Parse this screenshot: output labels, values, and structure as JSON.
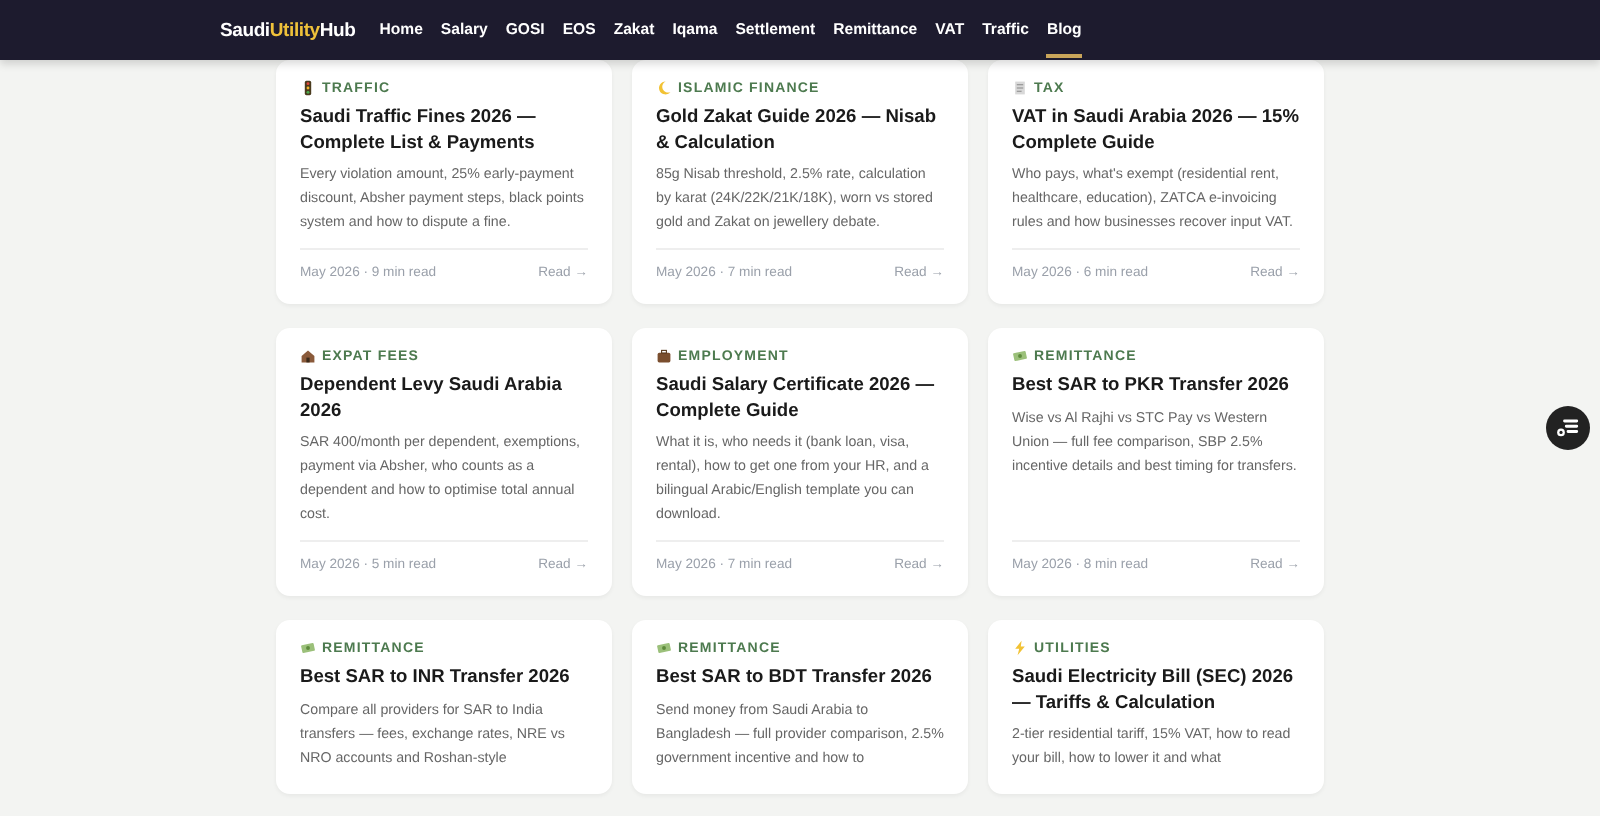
{
  "nav": {
    "logo": [
      {
        "text": "Saudi",
        "highlight": false
      },
      {
        "text": "Utility",
        "highlight": true
      },
      {
        "text": "Hub",
        "highlight": false
      }
    ],
    "links": [
      {
        "label": "Home",
        "selected": false
      },
      {
        "label": "Salary",
        "selected": false
      },
      {
        "label": "GOSI",
        "selected": false
      },
      {
        "label": "EOS",
        "selected": false
      },
      {
        "label": "Zakat",
        "selected": false
      },
      {
        "label": "Iqama",
        "selected": false
      },
      {
        "label": "Settlement",
        "selected": false
      },
      {
        "label": "Remittance",
        "selected": false
      },
      {
        "label": "VAT",
        "selected": false
      },
      {
        "label": "Traffic",
        "selected": false
      },
      {
        "label": "Blog",
        "selected": true
      }
    ]
  },
  "articles": [
    {
      "kind": "traffic",
      "category": "TRAFFIC",
      "title": "Saudi Traffic Fines 2026 — Complete List & Payments",
      "description": "Every violation amount, 25% early-payment discount, Absher payment steps, black points system and how to dispute a fine.",
      "meta": "May 2026 · 9 min read",
      "link": "Read →"
    },
    {
      "kind": "moon",
      "category": "ISLAMIC FINANCE",
      "title": "Gold Zakat Guide 2026 — Nisab & Calculation",
      "description": "85g Nisab threshold, 2.5% rate, calculation by karat (24K/22K/21K/18K), worn vs stored gold and Zakat on jewellery debate.",
      "meta": "May 2026 · 7 min read",
      "link": "Read →"
    },
    {
      "kind": "receipt",
      "category": "TAX",
      "title": "VAT in Saudi Arabia 2026 — 15% Complete Guide",
      "description": "Who pays, what's exempt (residential rent, healthcare, education), ZATCA e-invoicing rules and how businesses recover input VAT.",
      "meta": "May 2026 · 6 min read",
      "link": "Read →"
    },
    {
      "kind": "house",
      "category": "EXPAT FEES",
      "title": "Dependent Levy Saudi Arabia 2026",
      "description": "SAR 400/month per dependent, exemptions, payment via Absher, who counts as a dependent and how to optimise total annual cost.",
      "meta": "May 2026 · 5 min read",
      "link": "Read →"
    },
    {
      "kind": "briefcase",
      "category": "EMPLOYMENT",
      "title": "Saudi Salary Certificate 2026 — Complete Guide",
      "description": "What it is, who needs it (bank loan, visa, rental), how to get one from your HR, and a bilingual Arabic/English template you can download.",
      "meta": "May 2026 · 7 min read",
      "link": "Read →"
    },
    {
      "kind": "money",
      "category": "REMITTANCE",
      "title": "Best SAR to PKR Transfer 2026",
      "description": "Wise vs Al Rajhi vs STC Pay vs Western Union — full fee comparison, SBP 2.5% incentive details and best timing for transfers.",
      "meta": "May 2026 · 8 min read",
      "link": "Read →"
    },
    {
      "kind": "money",
      "category": "REMITTANCE",
      "title": "Best SAR to INR Transfer 2026",
      "description": "Compare all providers for SAR to India transfers — fees, exchange rates, NRE vs NRO accounts and Roshan-style"
    },
    {
      "kind": "money",
      "category": "REMITTANCE",
      "title": "Best SAR to BDT Transfer 2026",
      "description": "Send money from Saudi Arabia to Bangladesh — full provider comparison, 2.5% government incentive and how to"
    },
    {
      "kind": "bolt",
      "category": "UTILITIES",
      "title": "Saudi Electricity Bill (SEC) 2026 — Tariffs & Calculation",
      "description": "2-tier residential tariff, 15% VAT, how to read your bill, how to lower it and what"
    }
  ]
}
